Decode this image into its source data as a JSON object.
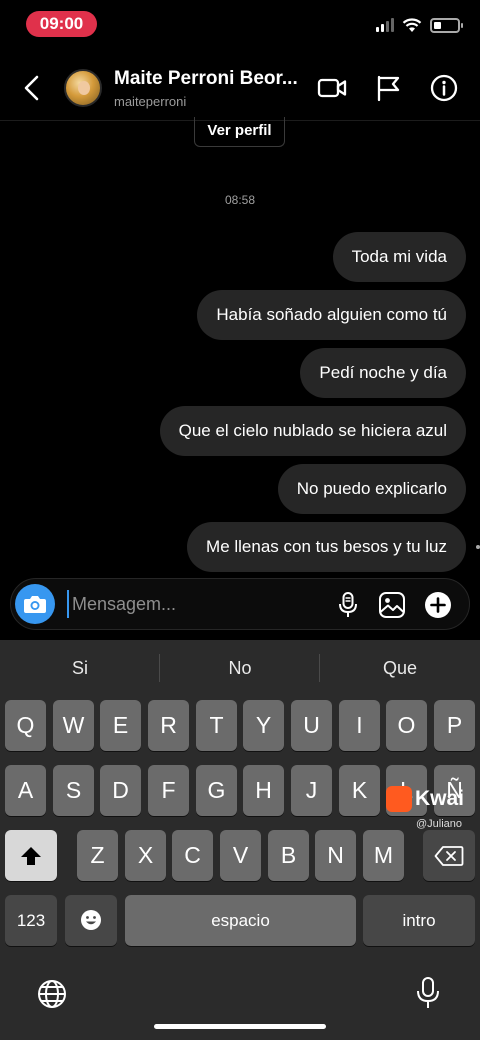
{
  "status_bar": {
    "time": "09:00",
    "time_pill_color": "#e0314b"
  },
  "header": {
    "contact_name": "Maite Perroni Beor...",
    "contact_handle": "maiteperroni",
    "icons": [
      "back-chevron",
      "video-camera",
      "flag",
      "info"
    ]
  },
  "profile_button": "Ver perfil",
  "timestamp": "08:58",
  "messages": [
    "Toda mi vida",
    "Había soñado alguien como tú",
    "Pedí noche y día",
    "Que el cielo nublado se hiciera azul",
    "No puedo explicarlo",
    "Me llenas con tus besos y tu luz"
  ],
  "composer": {
    "placeholder": "Mensagem...",
    "accent_color": "#3797f0",
    "icons": [
      "camera",
      "microphone",
      "image",
      "plus-circle"
    ]
  },
  "keyboard": {
    "suggestions": [
      "Si",
      "No",
      "Que"
    ],
    "row1": [
      "Q",
      "W",
      "E",
      "R",
      "T",
      "Y",
      "U",
      "I",
      "O",
      "P"
    ],
    "row2": [
      "A",
      "S",
      "D",
      "F",
      "G",
      "H",
      "J",
      "K",
      "L",
      "Ñ"
    ],
    "row3": [
      "Z",
      "X",
      "C",
      "V",
      "B",
      "N",
      "M"
    ],
    "numbers_key": "123",
    "space_key": "espacio",
    "return_key": "intro"
  },
  "watermark": {
    "brand": "Kwai",
    "user": "@Juliano"
  }
}
